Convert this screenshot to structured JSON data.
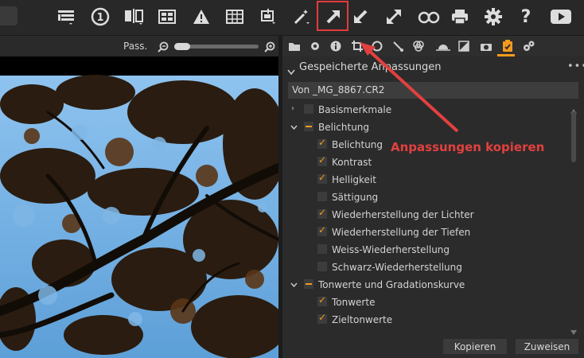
{
  "toolbar": {
    "icons": [
      "browser-icon",
      "single-view-icon",
      "compare-icon",
      "grid-view-icon",
      "exposure-warning-icon",
      "grid-overlay-icon",
      "move-icon",
      "magic-wand-icon",
      "copy-adjustments-icon",
      "apply-adjustments-icon",
      "expand-icon",
      "glasses-icon",
      "print-icon",
      "gear-icon",
      "help-icon",
      "play-icon"
    ],
    "help_label": "?",
    "counter_label": "1"
  },
  "viewer": {
    "pass_label": "Pass."
  },
  "panel": {
    "title": "Gespeicherte Anpassungen",
    "menu_dots": "•••",
    "source": "Von _MG_8867.CR2",
    "tree": [
      {
        "type": "group",
        "label": "Basismerkmale",
        "state": "unchecked",
        "expanded": false
      },
      {
        "type": "group",
        "label": "Belichtung",
        "state": "partial",
        "expanded": true
      },
      {
        "type": "item",
        "label": "Belichtung",
        "checked": true
      },
      {
        "type": "item",
        "label": "Kontrast",
        "checked": true
      },
      {
        "type": "item",
        "label": "Helligkeit",
        "checked": true
      },
      {
        "type": "item",
        "label": "Sättigung",
        "checked": false
      },
      {
        "type": "item",
        "label": "Wiederherstellung der Lichter",
        "checked": true
      },
      {
        "type": "item",
        "label": "Wiederherstellung der Tiefen",
        "checked": true
      },
      {
        "type": "item",
        "label": "Weiss-Wiederherstellung",
        "checked": false
      },
      {
        "type": "item",
        "label": "Schwarz-Wiederherstellung",
        "checked": false
      },
      {
        "type": "group",
        "label": "Tonwerte und Gradationskurve",
        "state": "partial",
        "expanded": true
      },
      {
        "type": "item",
        "label": "Tonwerte",
        "checked": true
      },
      {
        "type": "item",
        "label": "Zieltonwerte",
        "checked": true
      }
    ],
    "buttons": {
      "copy": "Kopieren",
      "apply": "Zuweisen"
    }
  },
  "annotation": {
    "text": "Anpassungen kopieren",
    "color": "#e2403f"
  },
  "colors": {
    "accent": "#f29a1d",
    "highlight_box": "#e33b3b",
    "sky": "#7fb7e6"
  }
}
